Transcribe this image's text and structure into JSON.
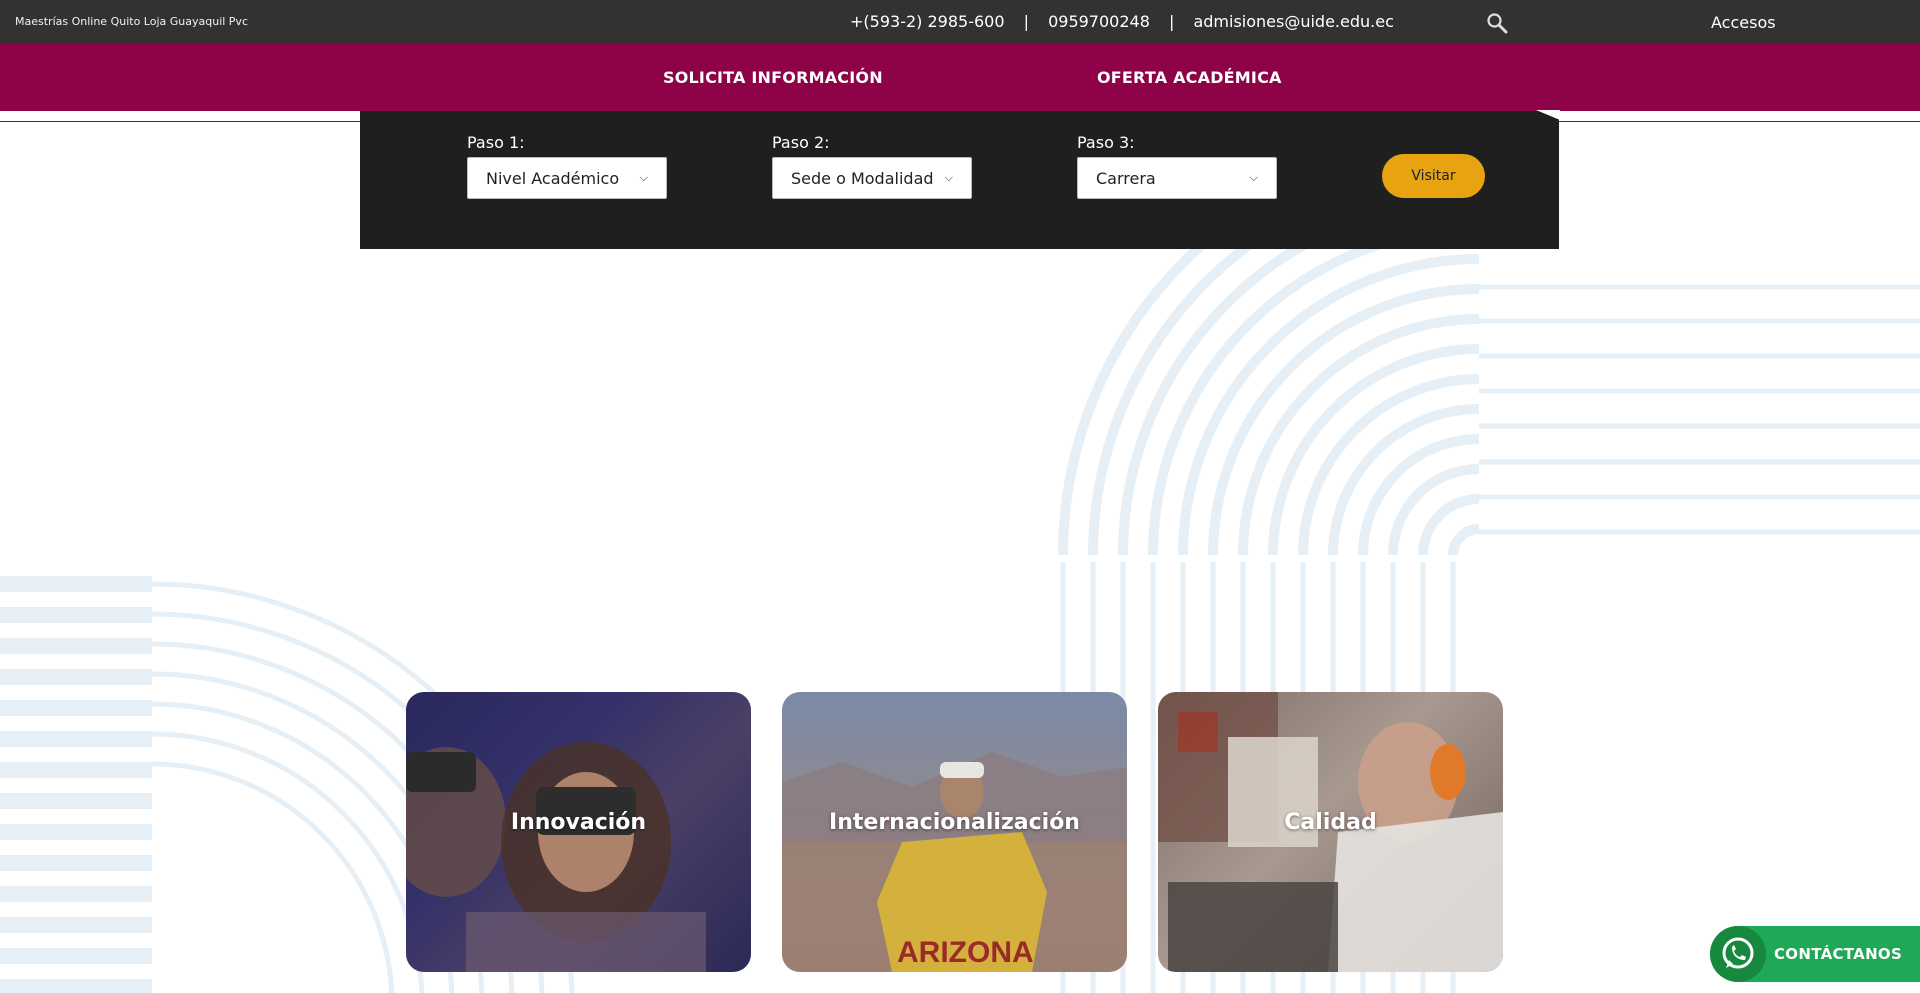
{
  "topbar": {
    "locations": "Maestrías Online Quito Loja Guayaquil Pvc",
    "phone1": "+(593-2) 2985-600",
    "separator": "|",
    "phone2": "0959700248",
    "email": "admisiones@uide.edu.ec",
    "search_icon": "search-icon",
    "accesos": "Accesos"
  },
  "menu": {
    "items": [
      {
        "label": "SOLICITA INFORMACIÓN"
      },
      {
        "label": "OFERTA ACADÉMICA"
      }
    ]
  },
  "finder": {
    "steps": [
      {
        "label": "Paso 1:",
        "selected": "Nivel Académico"
      },
      {
        "label": "Paso 2:",
        "selected": "Sede o Modalidad"
      },
      {
        "label": "Paso 3:",
        "selected": "Carrera"
      }
    ],
    "button": "Visitar"
  },
  "cards": [
    {
      "title": "Innovación"
    },
    {
      "title": "Internacionalización"
    },
    {
      "title": "Calidad"
    }
  ],
  "whatsapp": {
    "label": "CONTÁCTANOS",
    "icon": "whatsapp-icon",
    "color": "#1fa855"
  },
  "colors": {
    "brand": "#8e0347",
    "topbar": "#323232",
    "finder": "#1f1f1f",
    "accent": "#e8a313"
  }
}
